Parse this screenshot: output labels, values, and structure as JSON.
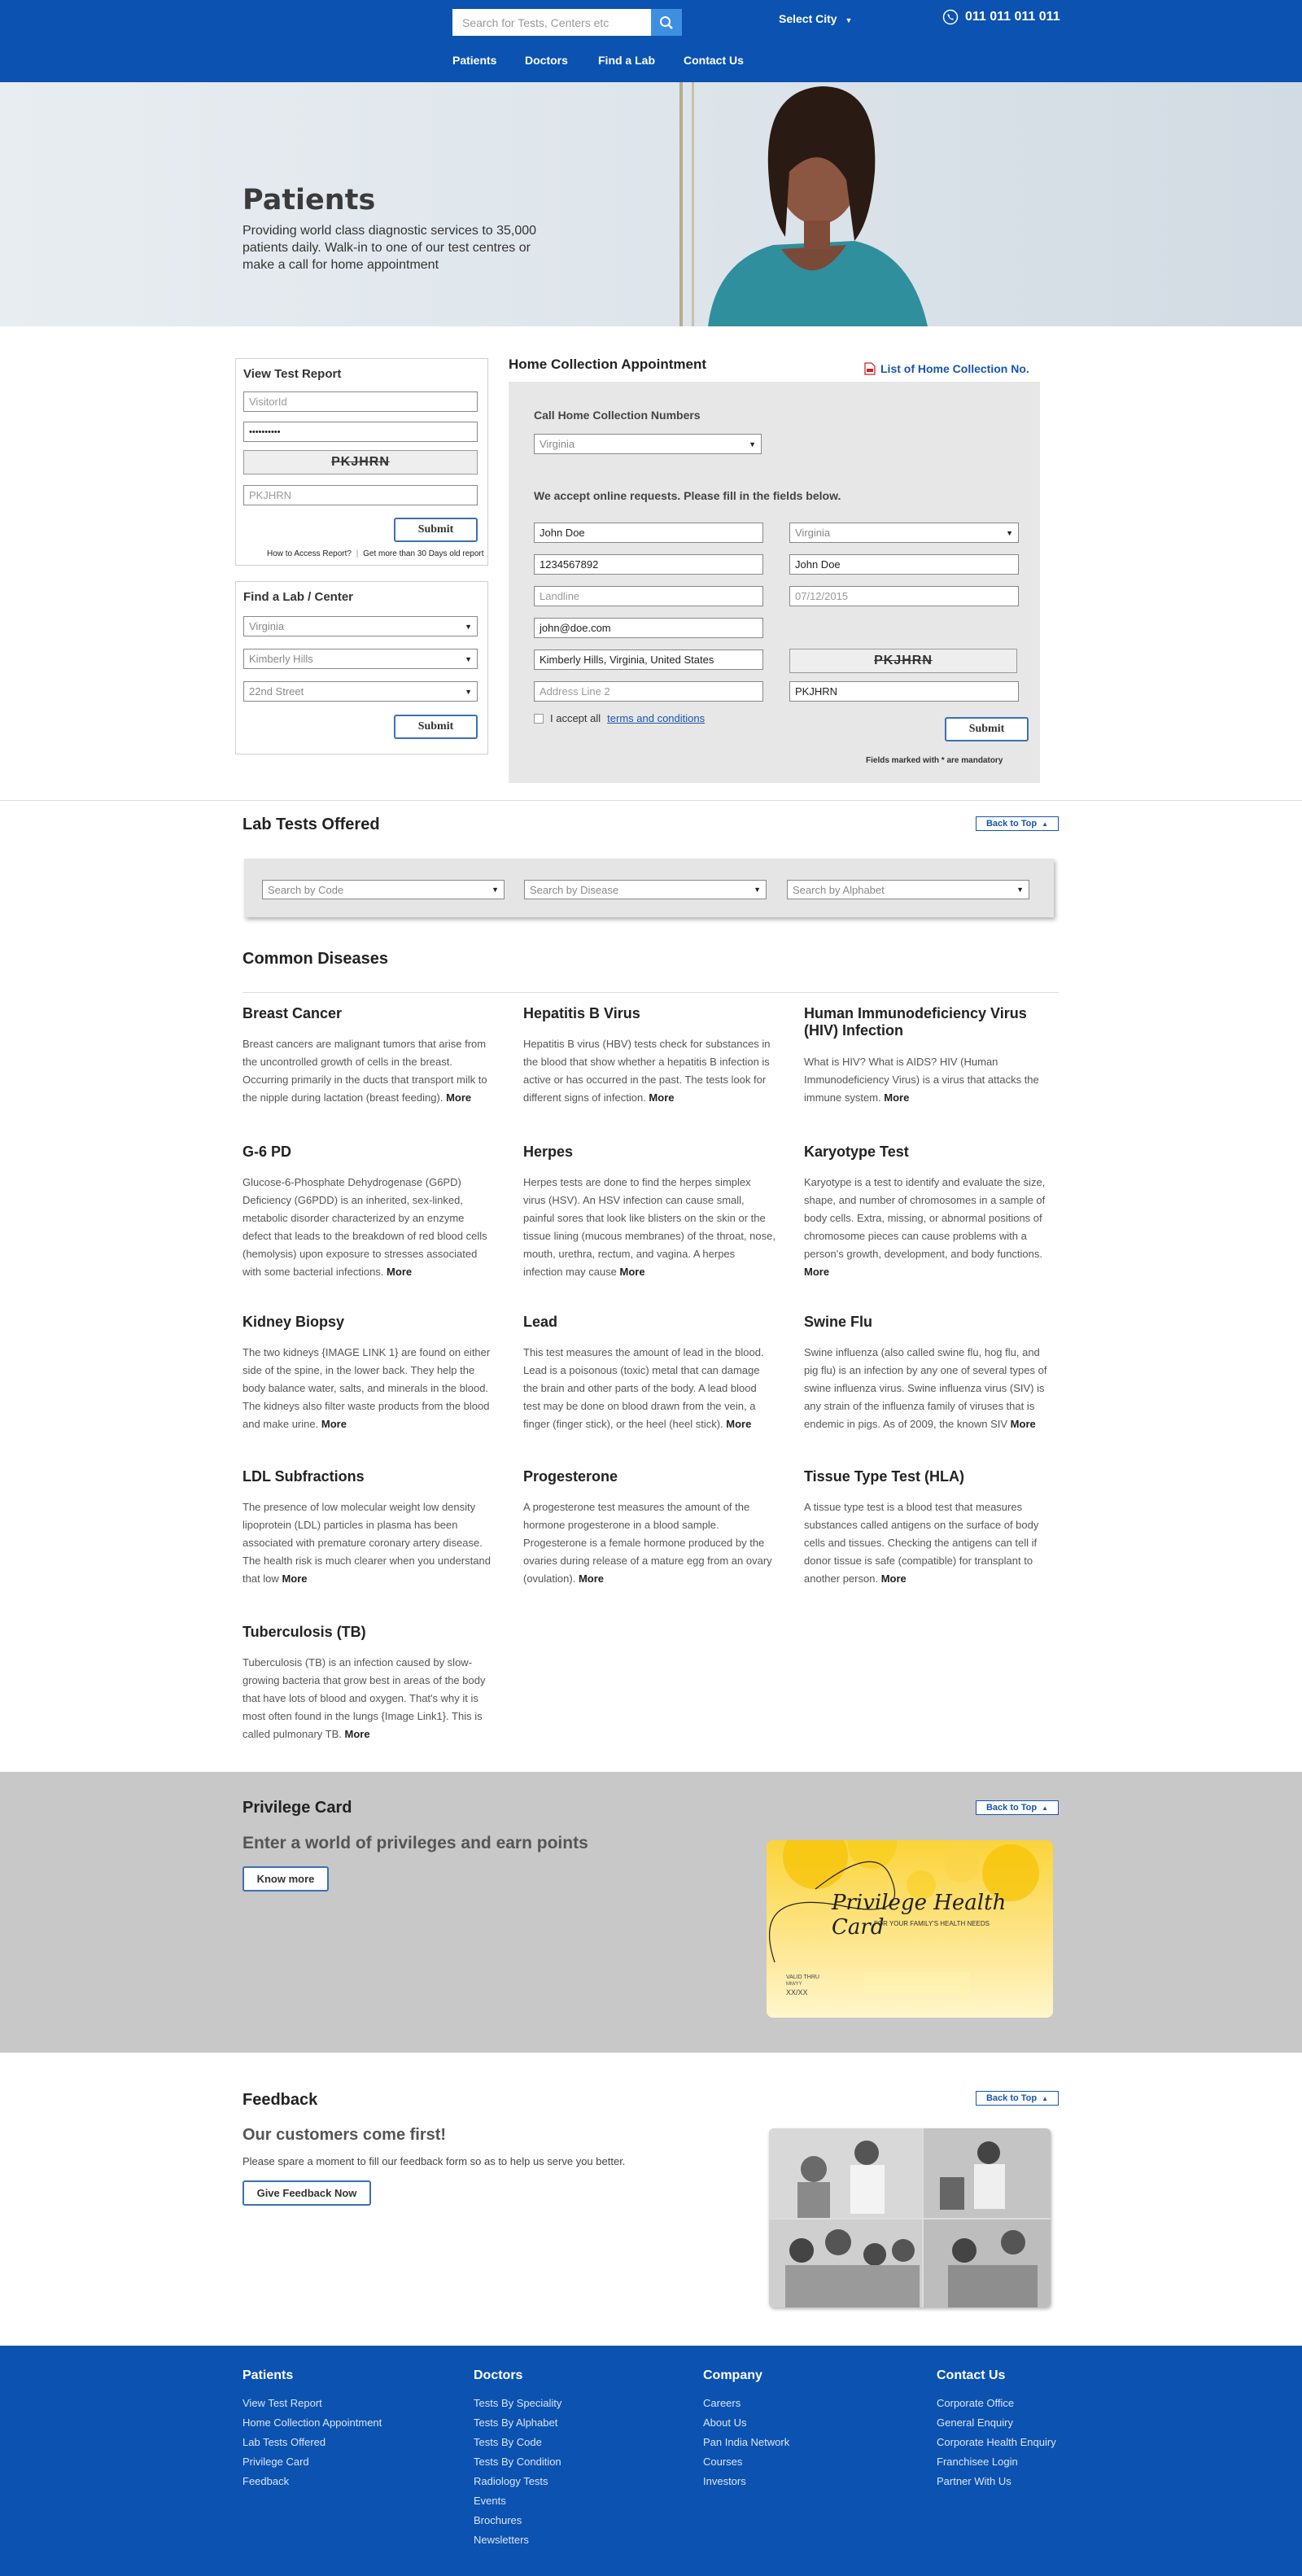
{
  "header": {
    "search_placeholder": "Search for Tests, Centers etc",
    "city_label": "Select City",
    "phone": "011 011 011 011",
    "nav": [
      "Patients",
      "Doctors",
      "Find a Lab",
      "Contact Us"
    ]
  },
  "hero": {
    "title": "Patients",
    "text": "Providing world class diagnostic services to 35,000 patients daily. Walk-in to one of our test centres or make a call for home appointment"
  },
  "view_report": {
    "title": "View Test Report",
    "visitor_placeholder": "VisitorId",
    "password_value": "••••••••••",
    "captcha": "PKJHRN",
    "captcha_input_placeholder": "PKJHRN",
    "submit": "Submit",
    "help_link": "How to Access Report?",
    "old_report_link": "Get more than 30 Days old report"
  },
  "find_lab": {
    "title": "Find a Lab / Center",
    "state": "Virginia",
    "area": "Kimberly Hills",
    "street": "22nd Street",
    "submit": "Submit"
  },
  "home_collection": {
    "title": "Home Collection Appointment",
    "list_link": "List of Home Collection No.",
    "call_heading": "Call Home Collection Numbers",
    "call_state": "Virginia",
    "online_heading": "We accept online requests. Please fill in the fields below.",
    "name": "John Doe",
    "mobile": "1234567892",
    "landline_placeholder": "Landline",
    "email": "john@doe.com",
    "address1": "Kimberly Hills, Virginia, United States",
    "address2_placeholder": "Address Line 2",
    "state": "Virginia",
    "patient_name": "John Doe",
    "date_placeholder": "07/12/2015",
    "captcha": "PKJHRN",
    "captcha_input": "PKJHRN",
    "accept_text": "I accept all",
    "terms_link": "terms and conditions",
    "submit": "Submit",
    "mandatory_note": "Fields marked with * are mandatory"
  },
  "lab_tests": {
    "title": "Lab Tests Offered",
    "back_to_top": "Back to Top",
    "by_code": "Search by Code",
    "by_disease": "Search by Disease",
    "by_alphabet": "Search by Alphabet"
  },
  "common_diseases": {
    "title": "Common Diseases",
    "more": "More",
    "items": [
      {
        "title": "Breast Cancer",
        "text": "Breast cancers are malignant tumors that arise from the uncontrolled growth of cells in the breast. Occurring primarily in the ducts that transport milk to the nipple during lactation (breast feeding)."
      },
      {
        "title": "Hepatitis B Virus",
        "text": "Hepatitis B virus (HBV) tests check for substances in the blood that show whether a hepatitis B infection is active or has occurred in the past. The tests look for different signs of infection."
      },
      {
        "title": "Human Immunodeficiency Virus (HIV) Infection",
        "text": "What is HIV? What is AIDS? HIV (Human Immunodeficiency Virus) is a virus that attacks the immune system."
      },
      {
        "title": "G-6 PD",
        "text": "Glucose-6-Phosphate Dehydrogenase (G6PD) Deficiency (G6PDD) is an inherited, sex-linked, metabolic disorder characterized by an enzyme defect that leads to the breakdown of red blood cells (hemolysis) upon exposure to stresses associated with some bacterial infections."
      },
      {
        "title": "Herpes",
        "text": "Herpes tests are done to find the herpes simplex virus (HSV). An HSV infection can cause small, painful sores that look like blisters on the skin or the tissue lining (mucous membranes) of the throat, nose, mouth, urethra, rectum, and vagina. A herpes infection may cause"
      },
      {
        "title": "Karyotype Test",
        "text": "Karyotype is a test to identify and evaluate the size, shape, and number of chromosomes in a sample of body cells. Extra, missing, or abnormal positions of chromosome pieces can cause problems with a person's growth, development, and body functions."
      },
      {
        "title": "Kidney Biopsy",
        "text": "The two kidneys {IMAGE LINK 1} are found on either side of the spine, in the lower back. They help the body balance water, salts, and minerals in the blood. The kidneys also filter waste products from the blood and make urine."
      },
      {
        "title": "Lead",
        "text": "This test measures the amount of lead in the blood. Lead is a poisonous (toxic) metal that can damage the brain and other parts of the body. A lead blood test may be done on blood drawn from the vein, a finger (finger stick), or the heel (heel stick)."
      },
      {
        "title": "Swine Flu",
        "text": "Swine influenza (also called swine flu, hog flu, and pig flu) is an infection by any one of several types of swine influenza virus. Swine influenza virus (SIV) is any strain of the influenza family of viruses that is endemic in pigs. As of 2009, the known SIV"
      },
      {
        "title": "LDL Subfractions",
        "text": "The presence of low molecular weight low density lipoprotein (LDL) particles in plasma has been associated with premature coronary artery disease. The health risk is much clearer when you understand that low"
      },
      {
        "title": "Progesterone",
        "text": "A progesterone test measures the amount of the hormone progesterone in a blood sample. Progesterone is a female hormone produced by the ovaries during release of a mature egg from an ovary (ovulation)."
      },
      {
        "title": "Tissue Type Test (HLA)",
        "text": "A tissue type test is a blood test that measures substances called antigens on the surface of body cells and tissues. Checking the antigens can tell if donor tissue is safe (compatible) for transplant to another person."
      },
      {
        "title": "Tuberculosis (TB)",
        "text": "Tuberculosis (TB) is an infection caused by slow-growing bacteria that grow best in areas of the body that have lots of blood and oxygen. That's why it is most often found in the lungs {Image Link1}. This is called pulmonary TB."
      }
    ]
  },
  "privilege": {
    "title": "Privilege Card",
    "back_to_top": "Back to Top",
    "tagline": "Enter a world of privileges and earn points",
    "button": "Know more",
    "card_name": "Privilege Health Card",
    "card_sub": "FOR YOUR FAMILY'S HEALTH NEEDS",
    "valid_thru": "VALID THRU",
    "month_year": "MM/YY",
    "card_holder": "XX/XX"
  },
  "feedback": {
    "title": "Feedback",
    "back_to_top": "Back to Top",
    "tagline": "Our customers come first!",
    "text": "Please spare a moment to fill our feedback form so as to help us serve you better.",
    "button": "Give Feedback Now"
  },
  "footer": {
    "columns": [
      {
        "heading": "Patients",
        "links": [
          "View Test Report",
          "Home Collection Appointment",
          "Lab Tests Offered",
          "Privilege Card",
          "Feedback"
        ]
      },
      {
        "heading": "Doctors",
        "links": [
          "Tests By Speciality",
          "Tests By Alphabet",
          "Tests By Code",
          "Tests By Condition",
          "Radiology Tests",
          "Events",
          "Brochures",
          "Newsletters"
        ]
      },
      {
        "heading": "Company",
        "links": [
          "Careers",
          "About Us",
          "Pan India Network",
          "Courses",
          "Investors"
        ]
      },
      {
        "heading": "Contact Us",
        "links": [
          "Corporate Office",
          "General Enquiry",
          "Corporate Health Enquiry",
          "Franchisee Login",
          "Partner With Us"
        ]
      }
    ]
  },
  "colors": {
    "brand_blue": "#0b52b1",
    "button_blue": "#3e8fe0",
    "gray_band": "#c8c8c8"
  }
}
